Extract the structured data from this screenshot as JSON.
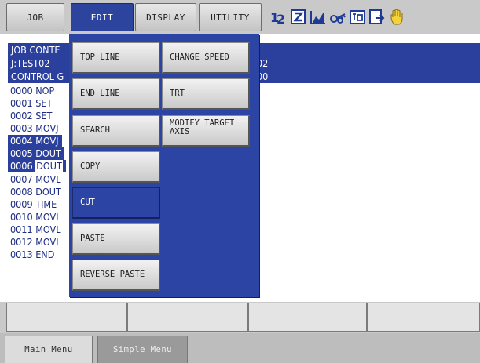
{
  "menu_tabs": [
    {
      "label": "JOB",
      "active": false
    },
    {
      "label": "EDIT",
      "active": true
    },
    {
      "label": "DISPLAY",
      "active": false
    },
    {
      "label": "UTILITY",
      "active": false
    }
  ],
  "status_icons": [
    "step-number-icon",
    "teach-mode-icon",
    "servo-chart-icon",
    "key-icon",
    "tool-icon",
    "screen-switch-icon",
    "hand-pointer-icon"
  ],
  "job": {
    "header": [
      {
        "label": "JOB CONTE",
        "value": ""
      },
      {
        "label": "J:TEST02",
        "value": "02"
      },
      {
        "label": "CONTROL G",
        "value": "00"
      }
    ],
    "lines": [
      {
        "no": "0000",
        "op": "NOP"
      },
      {
        "no": "0001",
        "op": "SET"
      },
      {
        "no": "0002",
        "op": "SET"
      },
      {
        "no": "0003",
        "op": "MOVJ"
      },
      {
        "no": "0004",
        "op": "MOVJ"
      },
      {
        "no": "0005",
        "op": "DOUT"
      },
      {
        "no": "0006",
        "op": "DOUT"
      },
      {
        "no": "0007",
        "op": "MOVL"
      },
      {
        "no": "0008",
        "op": "DOUT"
      },
      {
        "no": "0009",
        "op": "TIME"
      },
      {
        "no": "0010",
        "op": "MOVL"
      },
      {
        "no": "0011",
        "op": "MOVL"
      },
      {
        "no": "0012",
        "op": "MOVL"
      },
      {
        "no": "0013",
        "op": "END"
      }
    ]
  },
  "edit_menu": {
    "left": [
      "TOP LINE",
      "END LINE",
      "SEARCH",
      "COPY",
      "CUT",
      "PASTE",
      "REVERSE PASTE"
    ],
    "right": [
      "CHANGE SPEED",
      "TRT",
      "MODIFY TARGET\nAXIS"
    ],
    "active_item": "CUT"
  },
  "bottom_tabs": {
    "main_menu": "Main Menu",
    "simple_menu": "Simple Menu"
  },
  "colors": {
    "accent_blue": "#2c44a3",
    "text_blue": "#1c2c82",
    "icon_blue": "#1e3a96"
  }
}
